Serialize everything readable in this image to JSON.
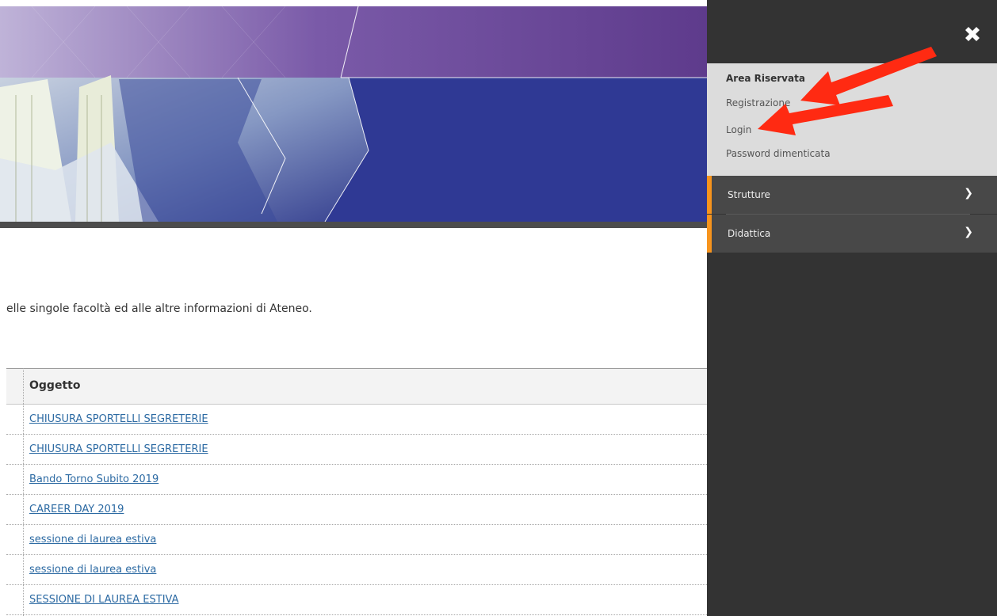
{
  "content": {
    "intro_text": "elle singole facoltà ed alle altre informazioni di Ateneo."
  },
  "news_table": {
    "header": "Oggetto",
    "rows": [
      "CHIUSURA SPORTELLI SEGRETERIE",
      "CHIUSURA SPORTELLI SEGRETERIE",
      "Bando Torno Subito 2019",
      "CAREER DAY 2019",
      "sessione di laurea estiva",
      "sessione di laurea estiva",
      "SESSIONE DI LAUREA ESTIVA"
    ]
  },
  "side_menu": {
    "close_icon": "close-icon",
    "reserved_area": {
      "title": "Area Riservata",
      "links": [
        "Registrazione",
        "Login",
        "Password dimenticata"
      ]
    },
    "items": [
      {
        "label": "Strutture",
        "icon": "chevron-right-icon"
      },
      {
        "label": "Didattica",
        "icon": "chevron-right-icon"
      }
    ]
  },
  "colors": {
    "menu_background": "#333333",
    "reserved_background": "#dcdcdc",
    "accent": "#f7941d",
    "annotation_arrow": "#ff2a12",
    "link": "#2c6aa3",
    "banner_purple": "#5e3b8c",
    "banner_blue": "#2f3994"
  }
}
